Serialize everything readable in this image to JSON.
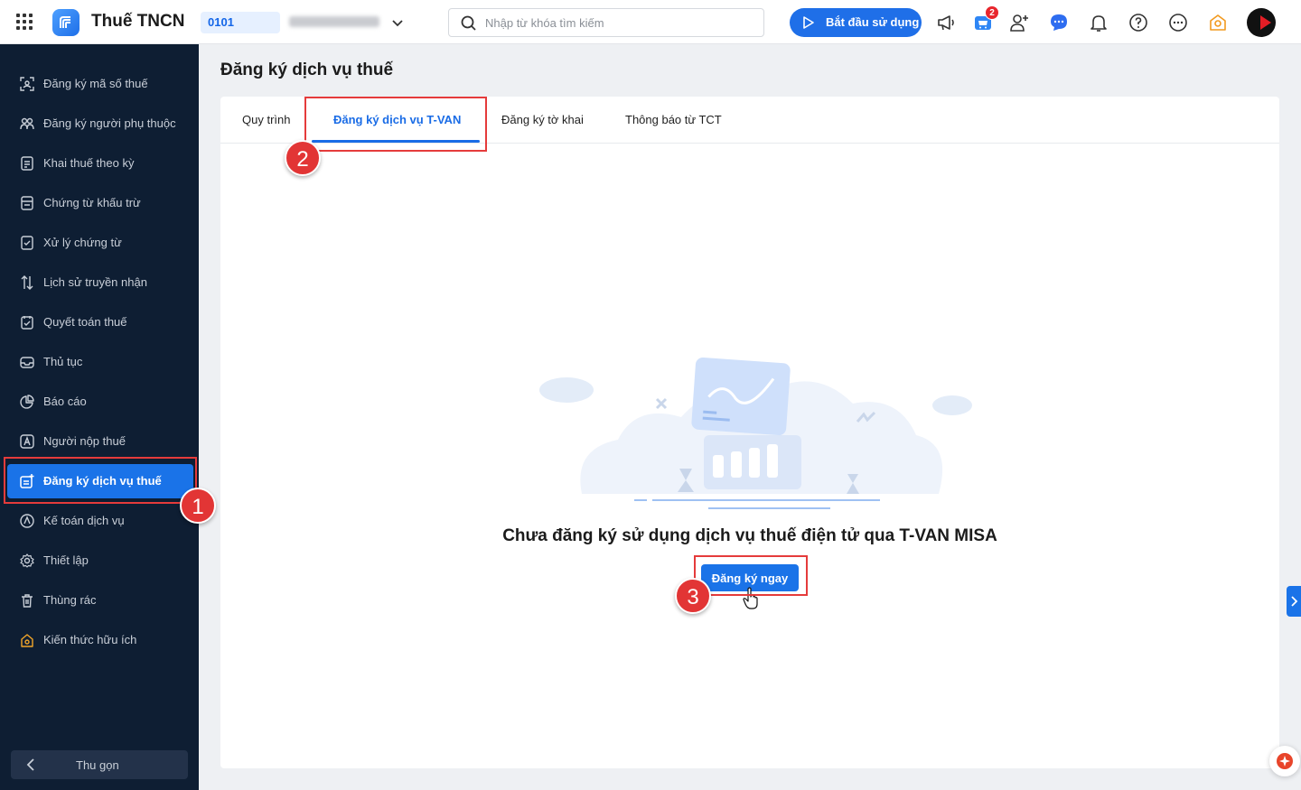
{
  "header": {
    "app_title": "Thuế TNCN",
    "tax_code": "0101",
    "search_placeholder": "Nhập từ khóa tìm kiếm",
    "start_label": "Bắt đầu sử dụng",
    "cart_badge": "2"
  },
  "sidebar": {
    "items": [
      {
        "label": "Đăng ký mã số thuế",
        "icon": "tax-id-scan-icon"
      },
      {
        "label": "Đăng ký người phụ thuộc",
        "icon": "dependents-icon"
      },
      {
        "label": "Khai thuế theo kỳ",
        "icon": "document-icon"
      },
      {
        "label": "Chứng từ khấu trừ",
        "icon": "voucher-icon"
      },
      {
        "label": "Xử lý chứng từ",
        "icon": "document-check-icon"
      },
      {
        "label": "Lịch sử truyền nhận",
        "icon": "transfer-arrows-icon"
      },
      {
        "label": "Quyết toán thuế",
        "icon": "settlement-icon"
      },
      {
        "label": "Thủ tục",
        "icon": "inbox-icon"
      },
      {
        "label": "Báo cáo",
        "icon": "pie-chart-icon"
      },
      {
        "label": "Người nộp thuế",
        "icon": "taxpayer-icon"
      },
      {
        "label": "Đăng ký dịch vụ thuế",
        "icon": "service-register-icon",
        "active": true
      },
      {
        "label": "Kế toán dịch vụ",
        "icon": "accounting-icon"
      },
      {
        "label": "Thiết lập",
        "icon": "gear-icon"
      },
      {
        "label": "Thùng rác",
        "icon": "trash-icon"
      },
      {
        "label": "Kiến thức hữu ích",
        "icon": "knowledge-icon"
      }
    ],
    "collapse_label": "Thu gọn"
  },
  "main": {
    "page_title": "Đăng ký dịch vụ thuế",
    "tabs": [
      {
        "label": "Quy trình"
      },
      {
        "label": "Đăng ký dịch vụ T-VAN",
        "active": true
      },
      {
        "label": "Đăng ký tờ khai"
      },
      {
        "label": "Thông báo từ TCT"
      }
    ],
    "empty_title": "Chưa đăng ký sử dụng dịch vụ thuế điện tử qua T-VAN MISA",
    "register_label": "Đăng ký ngay"
  },
  "annotations": {
    "step1": "1",
    "step2": "2",
    "step3": "3",
    "color": "#e53b3b"
  },
  "colors": {
    "primary": "#1a73e8",
    "sidebar_bg": "#0e1e33"
  }
}
